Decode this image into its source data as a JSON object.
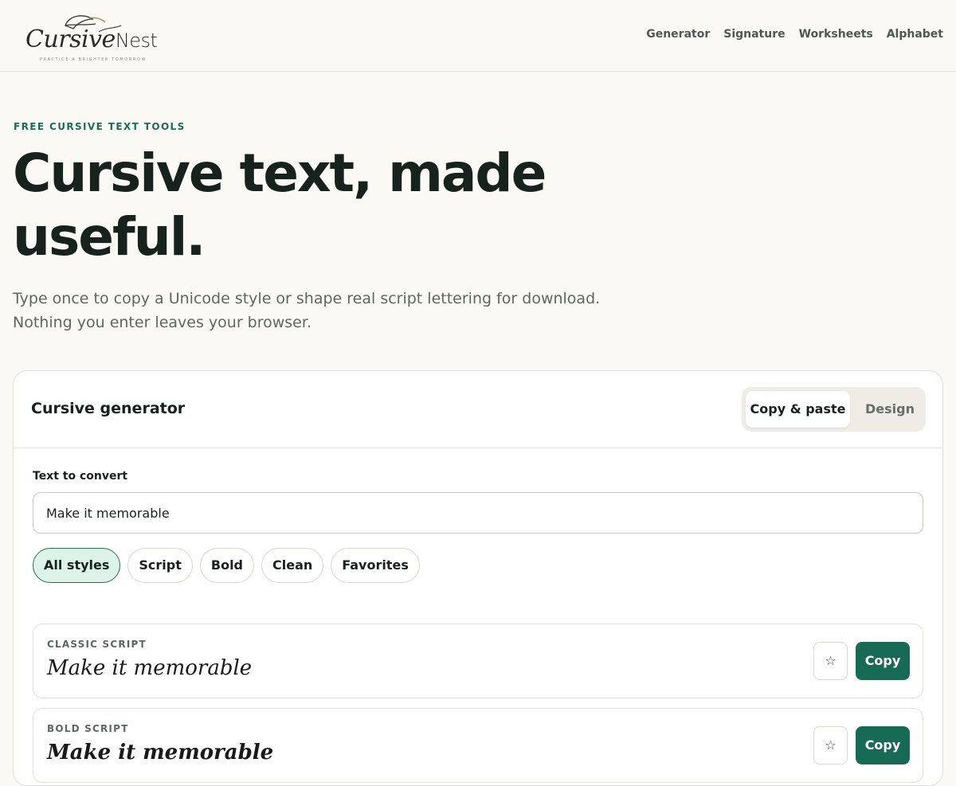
{
  "header": {
    "logo": {
      "word_script": "Cursive",
      "word_plain": "Nest",
      "tagline": "PRACTICE A BRIGHTER TOMORROW"
    },
    "nav": [
      "Generator",
      "Signature",
      "Worksheets",
      "Alphabet"
    ]
  },
  "hero": {
    "eyebrow": "FREE CURSIVE TEXT TOOLS",
    "title": "Cursive text, made useful.",
    "subtitle_line1": "Type once to copy a Unicode style or shape real script lettering for download.",
    "subtitle_line2": "Nothing you enter leaves your browser."
  },
  "generator": {
    "title": "Cursive generator",
    "modes": {
      "active": "Copy & paste",
      "other": "Design"
    },
    "input": {
      "label": "Text to convert",
      "value": "Make it memorable"
    },
    "filters": [
      "All styles",
      "Script",
      "Bold",
      "Clean",
      "Favorites"
    ],
    "active_filter": "All styles",
    "results": [
      {
        "label": "CLASSIC SCRIPT",
        "preview": "Make it memorable",
        "fav_icon": "☆",
        "copy_label": "Copy"
      },
      {
        "label": "BOLD SCRIPT",
        "preview": "Make it memorable",
        "fav_icon": "☆",
        "copy_label": "Copy"
      }
    ]
  },
  "colors": {
    "accent": "#176a54",
    "chip_active_bg": "#ddf3ea",
    "background": "#faf9f6"
  }
}
